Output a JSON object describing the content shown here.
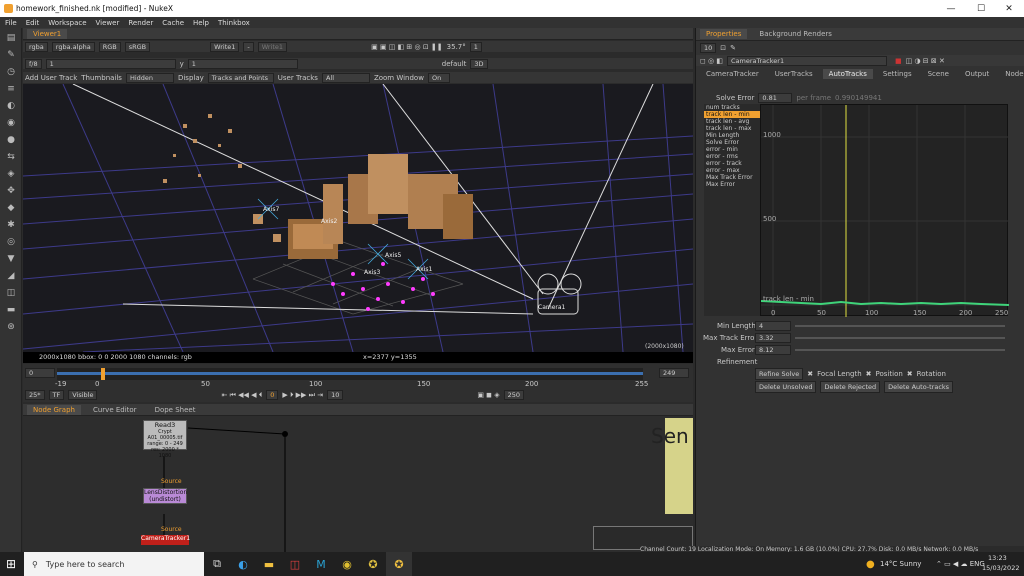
{
  "window": {
    "title": "homework_finished.nk [modified] - NukeX"
  },
  "menu": [
    "File",
    "Edit",
    "Workspace",
    "Viewer",
    "Render",
    "Cache",
    "Help",
    "Thinkbox"
  ],
  "viewer_tab": "Viewer1",
  "viewer_bar1": {
    "channels": "rgba",
    "alpha": "rgba.alpha",
    "mode": "RGB",
    "lut": "sRGB",
    "a_input": "Write1",
    "a_sep": "-",
    "b_input": "Write1",
    "zoom_info": "35.7°",
    "one": "1",
    "gain": "1"
  },
  "viewer_bar2": {
    "fstop": "f/8",
    "f_val": "1",
    "y_label": "y",
    "y_val": "1",
    "cam": "default",
    "view_mode": "3D"
  },
  "viewer_bar3": {
    "add_user_track": "Add User Track",
    "thumbnails_label": "Thumbnails",
    "thumbnails_val": "Hidden",
    "display_label": "Display",
    "display_val": "Tracks and Points",
    "user_tracks_label": "User Tracks",
    "user_tracks_val": "All",
    "zoom_window_label": "Zoom Window",
    "zoom_window_val": "On"
  },
  "viewport_labels": {
    "axis7": "Axis7",
    "axis2": "Axis2",
    "axis5": "Axis5",
    "axis1": "Axis1",
    "axis3": "Axis3",
    "camera1": "Camera1",
    "res": "(2000x1080)"
  },
  "viewer_status": {
    "info": "2000x1080  bbox: 0 0 2000 1080 channels: rgb",
    "coords": "x=2377 y=1355"
  },
  "timeline": {
    "start": "0",
    "first": "-19",
    "marks": [
      "0",
      "50",
      "100",
      "150",
      "200",
      "255"
    ],
    "end_right": "249",
    "fps": "25*",
    "tf": "TF",
    "visible": "Visible",
    "frame": "0",
    "inc": "10",
    "end_frame": "250"
  },
  "nodegraph": {
    "tabs": [
      "Node Graph",
      "Curve Editor",
      "Dope Sheet"
    ],
    "read_node": "Read3",
    "read_info1": "Crypt A01_00005.tif",
    "read_info2": "range: 0 - 249",
    "read_info3": "res: 2000 * 1080",
    "src1": "Source",
    "lens_node": "LensDistortion",
    "lens_sub": "(undistort)",
    "src2": "Source",
    "cam_node": "CameraTracker1",
    "bg_text": "Sen"
  },
  "props": {
    "tabs": [
      "Properties",
      "Background Renders"
    ],
    "count": "10",
    "node_name": "CameraTracker1",
    "subtabs": [
      "CameraTracker",
      "UserTracks",
      "AutoTracks",
      "Settings",
      "Scene",
      "Output",
      "Node"
    ],
    "solve_error_label": "Solve Error",
    "solve_error_val": "0.81",
    "per_frame_label": "per frame",
    "per_frame_val": "0.990149941",
    "list": [
      "num tracks",
      "track len - min",
      "track len - avg",
      "track len - max",
      "Min Length",
      "Solve Error",
      "error - min",
      "error - rms",
      "error - track",
      "error - max",
      "Max Track Error",
      "Max Error"
    ],
    "graph_labels": {
      "y1000": "1000",
      "y500": "500",
      "curve": "track len - min",
      "x_ticks": [
        "0",
        "50",
        "100",
        "150",
        "200",
        "250"
      ]
    },
    "min_length_label": "Min Length",
    "min_length_val": "4",
    "max_track_error_label": "Max Track Error",
    "max_track_error_val": "3.32",
    "max_error_label": "Max Error",
    "max_error_val": "8.12",
    "refinement_label": "Refinement",
    "refine_btn": "Refine Solve",
    "focal": "Focal Length",
    "position": "Position",
    "rotation": "Rotation",
    "del_unsolved": "Delete Unsolved",
    "del_rejected": "Delete Rejected",
    "del_auto": "Delete Auto-tracks"
  },
  "statusbar": "Channel Count: 19  Localization Mode: On  Memory: 1.6 GB (10.0%)  CPU: 27.7%  Disk: 0.0 MB/s  Network: 0.0 MB/s",
  "taskbar": {
    "search": "Type here to search",
    "weather": "14°C  Sunny",
    "time": "13:23",
    "date": "15/03/2022"
  }
}
